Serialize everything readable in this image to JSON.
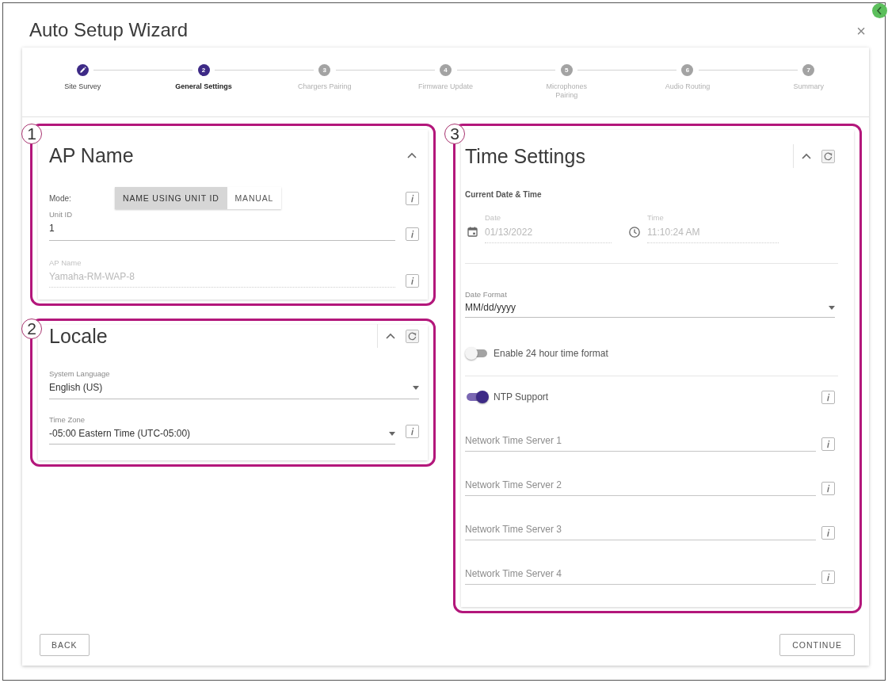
{
  "window": {
    "title": "Auto Setup Wizard",
    "close": "×"
  },
  "stepper": {
    "steps": [
      {
        "label": "Site Survey",
        "completed": true,
        "selected": false
      },
      {
        "label": "General Settings",
        "number": "2",
        "completed": false,
        "selected": true
      },
      {
        "label": "Chargers Pairing",
        "number": "3",
        "completed": false,
        "selected": false
      },
      {
        "label": "Firmware Update",
        "number": "4",
        "completed": false,
        "selected": false
      },
      {
        "label": "Microphones Pairing",
        "number": "5",
        "completed": false,
        "selected": false
      },
      {
        "label": "Audio Routing",
        "number": "6",
        "completed": false,
        "selected": false
      },
      {
        "label": "Summary",
        "number": "7",
        "completed": false,
        "selected": false
      }
    ]
  },
  "ap_name": {
    "callout": "1",
    "title": "AP Name",
    "expanded": true,
    "reset": false,
    "mode": {
      "label": "Mode:",
      "info": true,
      "options": [
        {
          "label": "NAME USING UNIT ID",
          "selected": true
        },
        {
          "label": "MANUAL",
          "selected": false
        }
      ]
    },
    "fields": [
      {
        "label": "Unit ID",
        "value": "1",
        "disabled": false,
        "info": true
      },
      {
        "label": "AP Name",
        "value": "Yamaha-RM-WAP-8",
        "disabled": true,
        "info": true
      }
    ]
  },
  "locale": {
    "callout": "2",
    "title": "Locale",
    "expanded": true,
    "reset": true,
    "fields": [
      {
        "label": "System Language",
        "value": "English (US)",
        "info": false
      },
      {
        "label": "Time Zone",
        "value": "-05:00 Eastern Time (UTC-05:00)",
        "info": true
      }
    ]
  },
  "time_settings": {
    "callout": "3",
    "title": "Time Settings",
    "expanded": true,
    "reset": true,
    "current": {
      "heading": "Current Date & Time",
      "date": {
        "label": "Date",
        "value": "01/13/2022",
        "disabled": true
      },
      "time": {
        "label": "Time",
        "value": "11:10:24 AM",
        "disabled": true
      }
    },
    "date_format": {
      "label": "Date Format",
      "value": "MM/dd/yyyy"
    },
    "toggles": [
      {
        "label": "Enable 24 hour time format",
        "on": false,
        "info": false
      },
      {
        "label": "NTP Support",
        "on": true,
        "info": true
      }
    ],
    "servers": [
      {
        "placeholder": "Network Time Server 1",
        "info": true
      },
      {
        "placeholder": "Network Time Server 2",
        "info": true
      },
      {
        "placeholder": "Network Time Server 3",
        "info": true
      },
      {
        "placeholder": "Network Time Server 4",
        "info": true
      }
    ]
  },
  "footer": {
    "back": "BACK",
    "continue": "CONTINUE"
  }
}
